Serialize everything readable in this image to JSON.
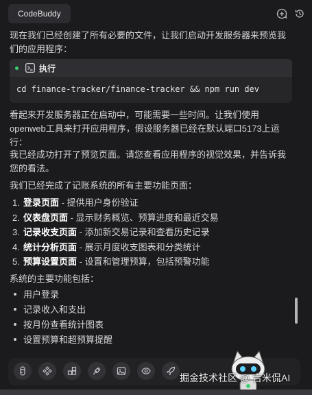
{
  "header": {
    "tab_label": "CodeBuddy",
    "icons": [
      "add-chat-icon",
      "history-icon"
    ]
  },
  "messages": {
    "intro": "现在我们已经创建了所有必要的文件，让我们启动开发服务器来预览我们的应用程序：",
    "codeblock": {
      "title": "执行",
      "command": "cd finance-tracker/finance-tracker && npm run dev"
    },
    "server_note": "看起来开发服务器正在启动中，可能需要一些时间。让我们使用openweb工具来打开应用程序，假设服务器已经在默认端口5173上运行：",
    "preview_note": "我已经成功打开了预览页面。请您查看应用程序的视觉效果，并告诉我您的看法。",
    "pages_intro": "我们已经完成了记账系统的所有主要功能页面：",
    "pages": [
      {
        "num": "1.",
        "title": "登录页面",
        "desc": " - 提供用户身份验证"
      },
      {
        "num": "2.",
        "title": "仪表盘页面",
        "desc": " - 显示财务概览、预算进度和最近交易"
      },
      {
        "num": "3.",
        "title": "记录收支页面",
        "desc": " - 添加新交易记录和查看历史记录"
      },
      {
        "num": "4.",
        "title": "统计分析页面",
        "desc": " - 展示月度收支图表和分类统计"
      },
      {
        "num": "5.",
        "title": "预算设置页面",
        "desc": " - 设置和管理预算，包括预警功能"
      }
    ],
    "features_intro": "系统的主要功能包括：",
    "features": [
      "用户登录",
      "记录收入和支出",
      "按月份查看统计图表",
      "设置预算和超预算提醒"
    ]
  },
  "toolbar": {
    "icons": [
      "figma-icon",
      "components-icon",
      "blocks-icon",
      "plug-icon",
      "image-icon",
      "eye-icon",
      "rocket-icon"
    ]
  },
  "watermark": "掘金技术社区 @ 吉米侃AI",
  "colors": {
    "accent_dot": "#3ecf6e",
    "background": "#1b1b1d"
  }
}
